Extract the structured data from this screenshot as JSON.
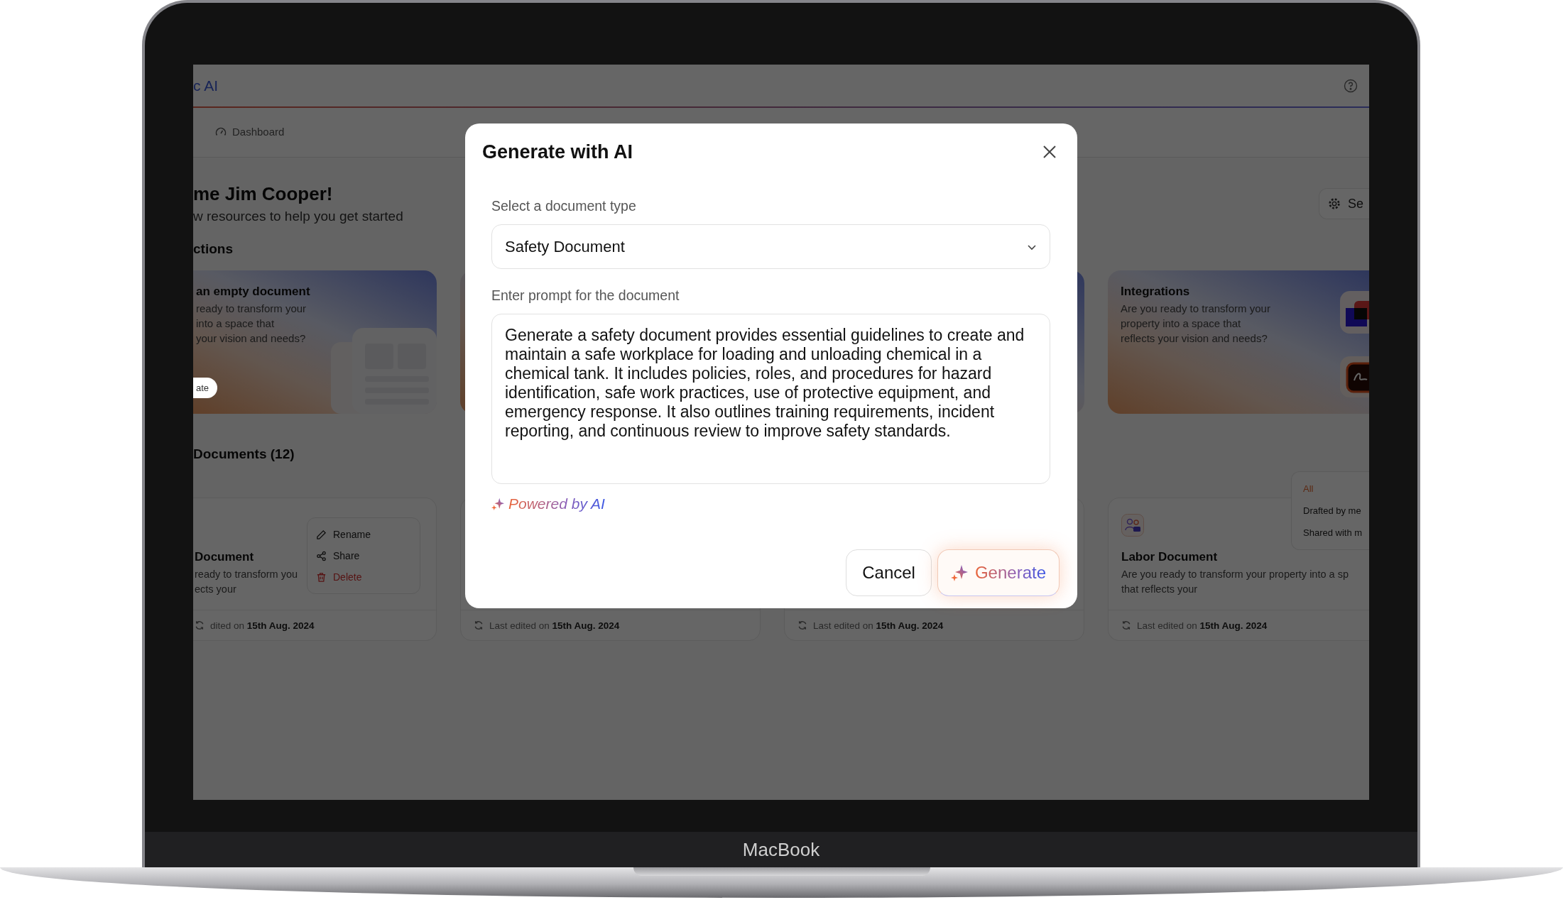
{
  "device": {
    "label": "MacBook"
  },
  "header": {
    "brand": "c AI"
  },
  "tabs": [
    {
      "label": "Dashboard",
      "selected": false
    }
  ],
  "welcome": {
    "title": "me Jim Cooper!",
    "subtitle": "w resources to help you get started",
    "settings_button": "Se"
  },
  "quick_actions": {
    "heading": "ctions",
    "cards": [
      {
        "kind": "create",
        "title": "an empty document",
        "lines": [
          "ready to transform your",
          "into a space that",
          "your vision and needs?"
        ],
        "button": "ate"
      },
      {
        "kind": "integrations",
        "title": "Integrations",
        "lines": [
          "Are you ready to transform your",
          "property into a space that",
          "reflects your vision and needs?"
        ]
      }
    ]
  },
  "documents": {
    "heading": "Documents (12)",
    "filter": [
      {
        "label": "All",
        "selected": true
      },
      {
        "label": "Drafted by me",
        "selected": false
      },
      {
        "label": "Shared with m",
        "selected": false
      }
    ],
    "cards": [
      {
        "title": "Document",
        "lines": [
          "ready to transform you",
          "ects your"
        ],
        "edited_label": "dited on",
        "date": "15th Aug. 2024",
        "menu": [
          {
            "kind": "rename",
            "label": "Rename"
          },
          {
            "kind": "share",
            "label": "Share"
          },
          {
            "kind": "delete",
            "label": "Delete"
          }
        ]
      },
      {
        "edited_label": "Last edited on",
        "date": "15th Aug. 2024"
      },
      {
        "edited_label": "Last edited on",
        "date": "15th Aug. 2024"
      },
      {
        "kind": "labor",
        "title": "Labor Document",
        "lines": [
          "Are you ready to transform your property into a sp",
          "that reflects your"
        ],
        "edited_label": "Last edited on",
        "date": "15th Aug. 2024"
      }
    ]
  },
  "modal": {
    "title": "Generate with AI",
    "type_label": "Select a document type",
    "type_value": "Safety Document",
    "prompt_label": "Enter prompt for the document",
    "prompt_value": "Generate a safety document provides essential guidelines to create and maintain a safe workplace for loading and unloading chemical in a chemical tank. It includes policies, roles, and procedures for hazard identification, safe work practices, use of protective equipment, and emergency response. It also outlines training requirements, incident reporting, and continuous review to improve safety standards.",
    "powered": "Powered by AI",
    "buttons": [
      {
        "kind": "cancel",
        "label": "Cancel"
      },
      {
        "kind": "generate",
        "label": "Generate"
      }
    ]
  }
}
